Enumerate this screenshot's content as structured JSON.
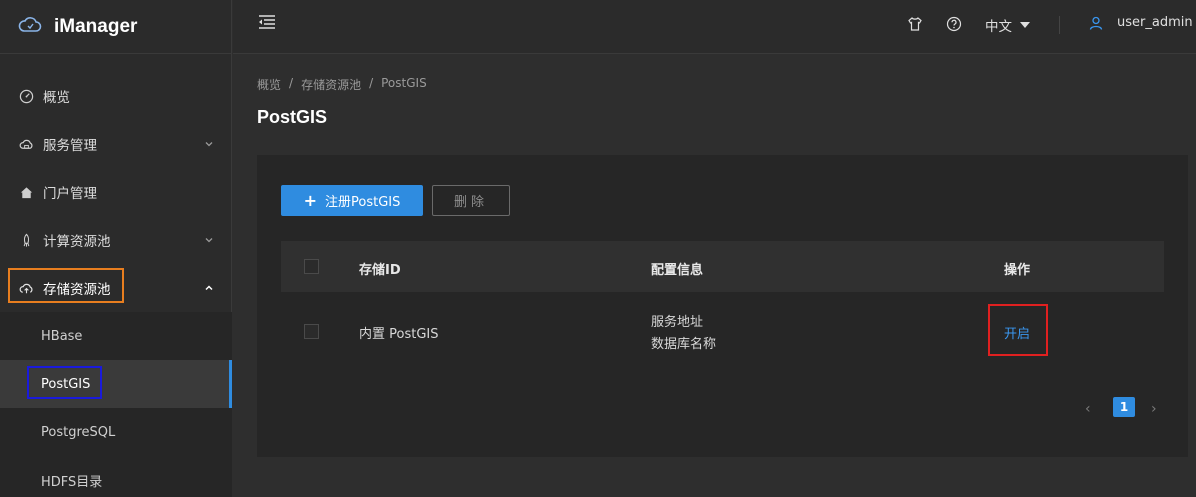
{
  "app": {
    "title": "iManager"
  },
  "sidebar": {
    "items": [
      {
        "label": "概览",
        "icon": "dashboard-icon"
      },
      {
        "label": "服务管理",
        "icon": "cloud-service-icon",
        "expandable": true,
        "expanded": false
      },
      {
        "label": "门户管理",
        "icon": "home-icon"
      },
      {
        "label": "计算资源池",
        "icon": "rocket-icon",
        "expandable": true,
        "expanded": false
      },
      {
        "label": "存储资源池",
        "icon": "cloud-upload-icon",
        "expandable": true,
        "expanded": true
      }
    ],
    "subitems": [
      {
        "label": "HBase",
        "active": false
      },
      {
        "label": "PostGIS",
        "active": true
      },
      {
        "label": "PostgreSQL",
        "active": false
      },
      {
        "label": "HDFS目录",
        "active": false
      }
    ]
  },
  "header": {
    "language": "中文",
    "user": "user_admin"
  },
  "breadcrumb": [
    "概览",
    "存储资源池",
    "PostGIS"
  ],
  "breadcrumb_sep": "/",
  "page": {
    "title": "PostGIS",
    "register_button": "注册PostGIS",
    "delete_button": "删除"
  },
  "table": {
    "columns": [
      "存储ID",
      "配置信息",
      "操作"
    ],
    "rows": [
      {
        "id": "内置 PostGIS",
        "config_line1": "服务地址",
        "config_line2": "数据库名称",
        "action": "开启"
      }
    ]
  },
  "pagination": {
    "current": "1"
  },
  "colors": {
    "accent": "#2f8ce0",
    "highlight_orange": "#e87e1f",
    "highlight_blue": "#1a1adc",
    "highlight_red": "#e02020"
  }
}
